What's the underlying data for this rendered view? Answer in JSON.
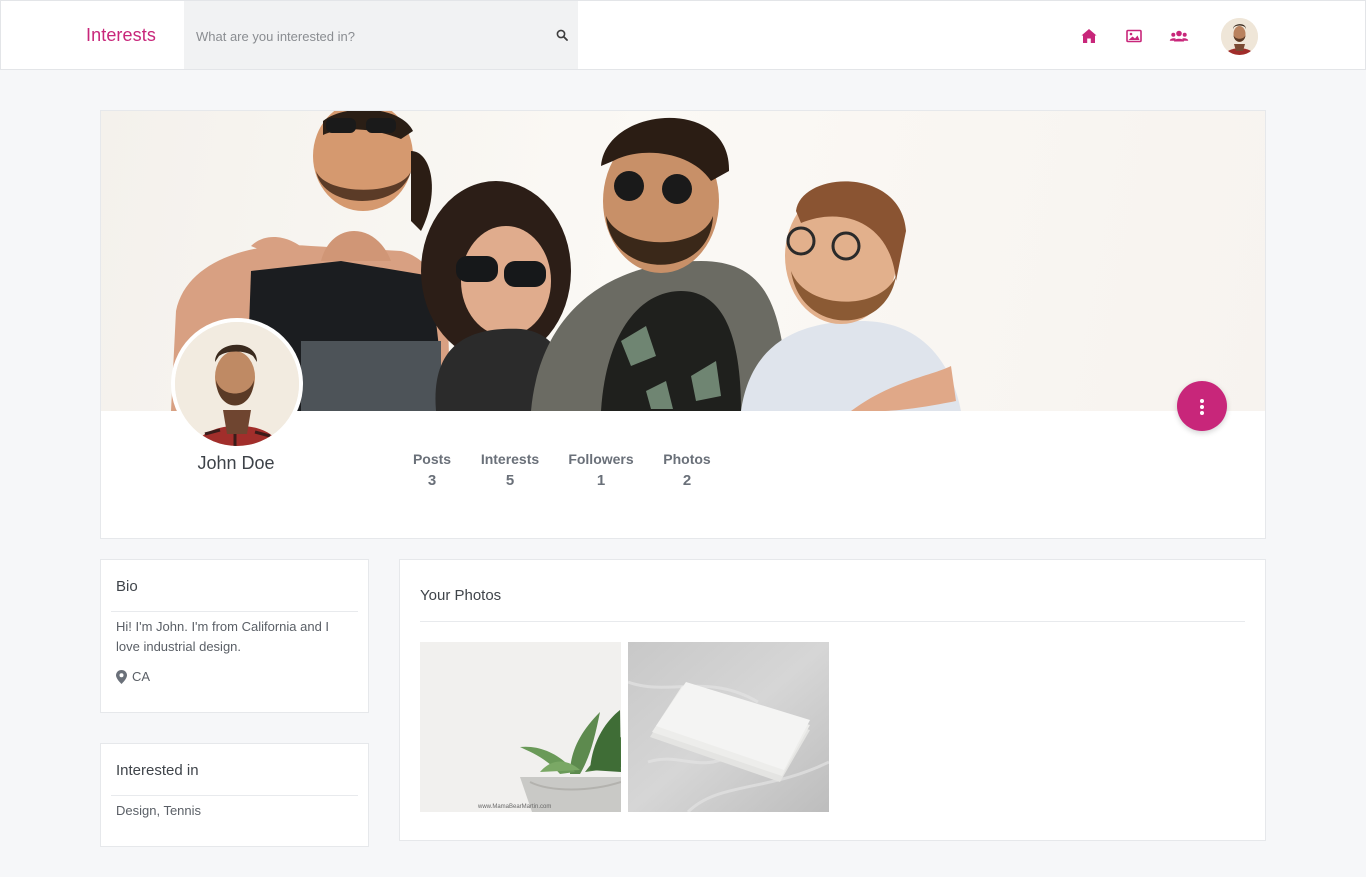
{
  "app": {
    "brand": "Interests"
  },
  "search": {
    "placeholder": "What are you interested in?"
  },
  "nav": {
    "icons": [
      "home-icon",
      "image-icon",
      "users-icon"
    ],
    "accent": "#c8267a"
  },
  "profile": {
    "name": "John Doe",
    "stats": [
      {
        "label": "Posts",
        "value": "3"
      },
      {
        "label": "Interests",
        "value": "5"
      },
      {
        "label": "Followers",
        "value": "1"
      },
      {
        "label": "Photos",
        "value": "2"
      }
    ]
  },
  "bio": {
    "title": "Bio",
    "text": "Hi! I'm John. I'm from California and I love industrial design.",
    "location": "CA"
  },
  "interested": {
    "title": "Interested in",
    "text": "Design, Tennis"
  },
  "photos": {
    "title": "Your Photos",
    "watermark": "www.MamaBearMartin.com"
  }
}
